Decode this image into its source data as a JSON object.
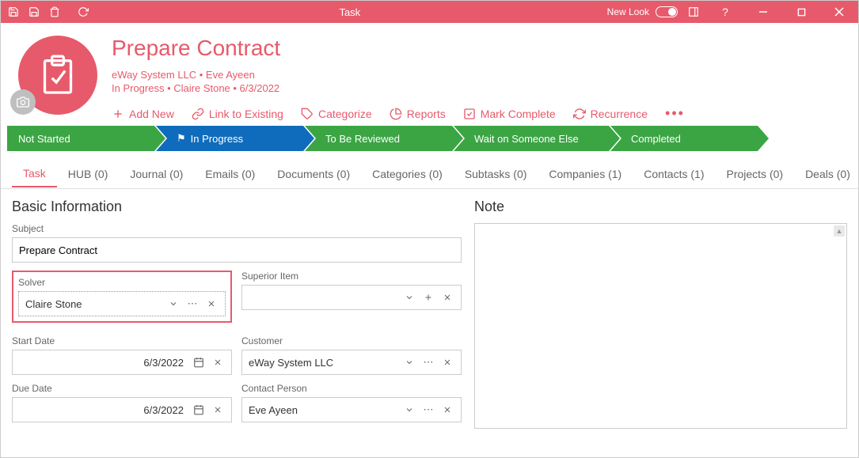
{
  "titlebar": {
    "title": "Task",
    "new_look": "New Look"
  },
  "header": {
    "title": "Prepare Contract",
    "sub1": "eWay System LLC • Eve Ayeen",
    "sub2": "In Progress • Claire Stone • 6/3/2022",
    "actions": {
      "add_new": "Add New",
      "link_existing": "Link to Existing",
      "categorize": "Categorize",
      "reports": "Reports",
      "mark_complete": "Mark Complete",
      "recurrence": "Recurrence"
    }
  },
  "workflow": {
    "s0": "Not Started",
    "s1": "In Progress",
    "s2": "To Be Reviewed",
    "s3": "Wait on Someone Else",
    "s4": "Completed"
  },
  "tabs": {
    "t0": "Task",
    "t1": "HUB (0)",
    "t2": "Journal (0)",
    "t3": "Emails (0)",
    "t4": "Documents (0)",
    "t5": "Categories (0)",
    "t6": "Subtasks (0)",
    "t7": "Companies (1)",
    "t8": "Contacts (1)",
    "t9": "Projects (0)",
    "t10": "Deals (0)"
  },
  "form": {
    "section_basic": "Basic Information",
    "section_note": "Note",
    "labels": {
      "subject": "Subject",
      "solver": "Solver",
      "superior": "Superior Item",
      "start_date": "Start Date",
      "customer": "Customer",
      "due_date": "Due Date",
      "contact": "Contact Person"
    },
    "values": {
      "subject": "Prepare Contract",
      "solver": "Claire Stone",
      "superior": "",
      "start_date": "6/3/2022",
      "customer": "eWay System LLC",
      "due_date": "6/3/2022",
      "contact": "Eve Ayeen"
    }
  }
}
